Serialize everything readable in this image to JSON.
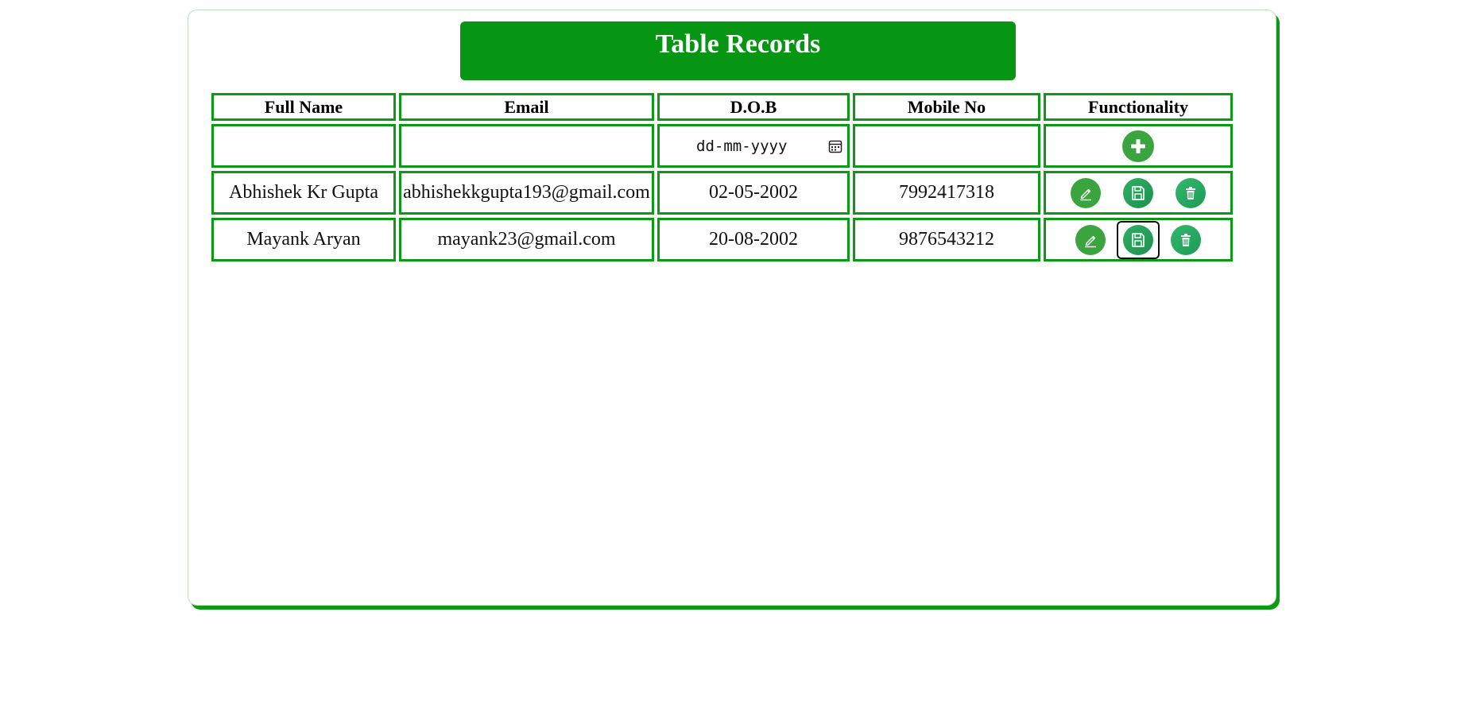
{
  "header": {
    "title": "Table Records"
  },
  "table": {
    "columns": [
      "Full Name",
      "Email",
      "D.O.B",
      "Mobile No",
      "Functionality"
    ],
    "input_row": {
      "dob_placeholder": "dd-mm-yyyy"
    },
    "rows": [
      {
        "full_name": "Abhishek Kr Gupta",
        "email": "abhishekkgupta193@gmail.com",
        "dob": "02-05-2002",
        "mobile": "7992417318"
      },
      {
        "full_name": "Mayank Aryan",
        "email": "mayank23@gmail.com",
        "dob": "20-08-2002",
        "mobile": "9876543212"
      }
    ]
  },
  "icons": {
    "add": "plus-icon",
    "edit": "pencil-icon",
    "save": "floppy-disk-icon",
    "delete": "trash-icon",
    "date_picker": "calendar-icon"
  },
  "colors": {
    "accent": "#079514",
    "border": "#0b9a14",
    "button_green": "#3aa43f",
    "button_teal": "#1e8f52"
  }
}
